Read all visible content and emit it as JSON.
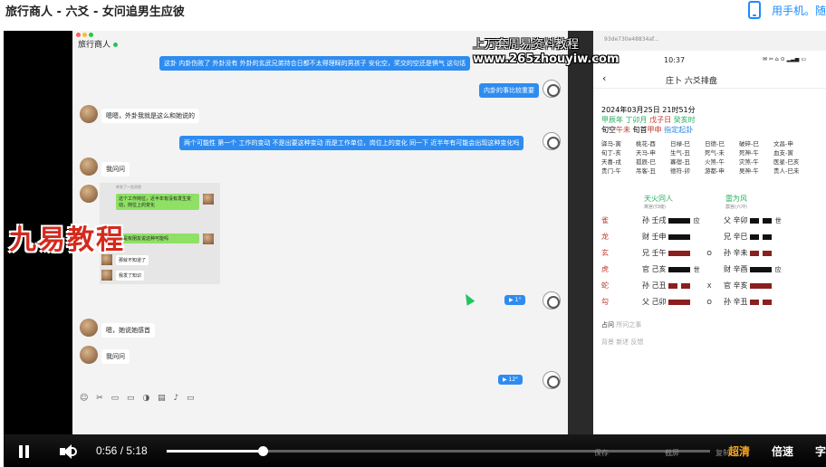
{
  "page": {
    "title": "旅行商人 - 六爻 - 女问追男生应彼",
    "phone_link": "用手机。随"
  },
  "watermark": {
    "line1": "上万套周易资料教程",
    "line2": "www.265zhouyiw.com",
    "logo": "九易教程"
  },
  "chat": {
    "contact_name": "旅行商人",
    "messages": [
      {
        "side": "right",
        "text": "这卦 内卦伤败了 外卦没有 外卦的玄武兄弟持合日都不太得理睬的男孩子 安化空，奖交的空还是惧气 这句话"
      },
      {
        "side": "right",
        "text": "内卦的事比较重要"
      },
      {
        "side": "left",
        "text": "嗯嗯，外卦我就是这么和她说的"
      },
      {
        "side": "right",
        "text": "两个可能性 第一个 工作的变动 不是出要这种变动 而是工作单位，岗位上的变化 同一下 近半年有可能会出现这种变化吗"
      },
      {
        "side": "left",
        "text": "我问问"
      },
      {
        "side": "right",
        "voice": "\"",
        "duration": "1\""
      },
      {
        "side": "left",
        "text": "嗯，她说她感首"
      },
      {
        "side": "left",
        "text": "我问问"
      },
      {
        "side": "right",
        "voice": "\"",
        "duration": "12\""
      }
    ],
    "image_card": {
      "header": "转发了一些消息",
      "msg1": "这个工作岗位，近半年有没有发生变动，岗位上的变化",
      "msg2": "你是有朋友说这种可能吗",
      "msg3": "那就不知道了",
      "msg4": "我发了知识"
    },
    "toolbar": "☺ ✂ ▭ ▭ ◑ ▤ ♪ ▭"
  },
  "phone": {
    "browser_url": "93de730e48834af...",
    "time": "10:37",
    "status_icons": "✉ ✂ ⌂ ⊙ ▂▃▅ ▭",
    "nav_back": "‹",
    "nav_title": "庄卜 六爻排盘",
    "date": "2024年03月25日 21时51分",
    "ganzhi": [
      "甲辰年",
      "丁卯月",
      "戊子日",
      "癸亥时"
    ],
    "xunkong": [
      "旬空",
      "午未",
      "旬首",
      "甲申",
      "指定起卦"
    ],
    "shensha": [
      [
        "驿马-寅",
        "桃花-酉",
        "日禄-巳",
        "日德-巳",
        "破碎-巳",
        "文昌-申"
      ],
      [
        "旬丁-亥",
        "天马-申",
        "生气-丑",
        "死气-未",
        "死神-午",
        "血支-寅"
      ],
      [
        "天喜-戌",
        "孤辰-巳",
        "寡宿-丑",
        "火煞-午",
        "灾煞-午",
        "医星-巳亥"
      ],
      [
        "贵门-午",
        "吊客-丑",
        "德符-卯",
        "游都-申",
        "吴神-午",
        "贵人-巳未"
      ]
    ],
    "main_gua": {
      "name": "天火同人",
      "sub": "离宫(归魂)"
    },
    "changed_gua": {
      "name": "雷为风",
      "sub": "震宫(六冲)"
    },
    "yao": [
      {
        "god": "雀",
        "left": "孙 壬戌",
        "left_mark": "应",
        "right": "父 辛卯",
        "right_mark": "世",
        "left_bar": "solid",
        "right_bar": "brokenk",
        "change": ""
      },
      {
        "god": "龙",
        "left": "财 壬申",
        "left_mark": "",
        "right": "兄 辛巳",
        "right_mark": "",
        "left_bar": "solid",
        "right_bar": "brokenk",
        "change": ""
      },
      {
        "god": "玄",
        "left": "兄 壬午",
        "left_mark": "",
        "right": "孙 辛未",
        "right_mark": "",
        "left_bar": "solidr",
        "right_bar": "broken",
        "change": "O"
      },
      {
        "god": "虎",
        "left": "官 己亥",
        "left_mark": "世",
        "right": "财 辛酉",
        "right_mark": "应",
        "left_bar": "solid",
        "right_bar": "solid",
        "change": ""
      },
      {
        "god": "蛇",
        "left": "孙 己丑",
        "left_mark": "",
        "right": "官 辛亥",
        "right_mark": "",
        "left_bar": "broken",
        "right_bar": "solidr",
        "change": "X"
      },
      {
        "god": "勾",
        "left": "父 己卯",
        "left_mark": "",
        "right": "孙 辛丑",
        "right_mark": "",
        "left_bar": "solidr",
        "right_bar": "broken",
        "change": "O"
      }
    ],
    "divination": {
      "label": "占问",
      "value": "所问之事"
    },
    "background": {
      "label": "背景",
      "value": "新述 反馈"
    },
    "footer_ghost": [
      "保存",
      "截屏",
      "复制"
    ]
  },
  "player": {
    "current": "0:56",
    "duration": "5:18",
    "progress": 0.176,
    "quality": "超清",
    "speed": "倍速",
    "subtitle": "字"
  },
  "colors": {
    "accent": "#2e8cf0",
    "quality": "#f5a623",
    "logo": "#d42a1e"
  }
}
